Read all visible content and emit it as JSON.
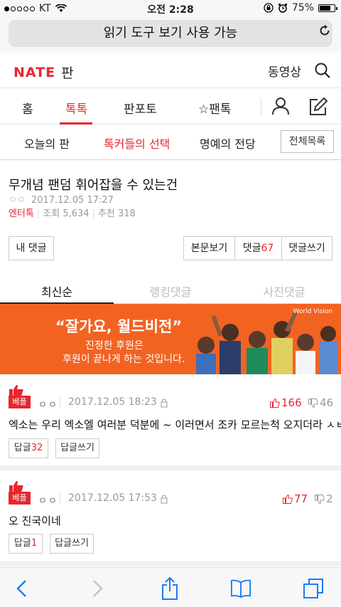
{
  "status_bar": {
    "carrier": "KT",
    "time": "오전 2:28",
    "battery_percent": "75%",
    "battery_level": 0.75
  },
  "url_bar": {
    "text": "읽기 도구 보기 사용 가능"
  },
  "header": {
    "logo": "NATE",
    "section": "판",
    "video_link": "동영상"
  },
  "main_nav": {
    "items": [
      {
        "label": "홈"
      },
      {
        "label": "톡톡"
      },
      {
        "label": "판포토"
      },
      {
        "label": "☆팬톡"
      }
    ],
    "active": "톡톡"
  },
  "sub_nav": {
    "items": [
      {
        "label": "오늘의 판"
      },
      {
        "label": "톡커들의 선택"
      },
      {
        "label": "명예의 전당"
      }
    ],
    "active": "톡커들의 선택",
    "full_list": "전체목록"
  },
  "article": {
    "title": "무개념 팬덤 휘어잡을 수 있는건",
    "author": "ㅇㅇ",
    "date": "2017.12.05 17:27",
    "category": "엔터톡",
    "views": "조회 5,634",
    "recommends": "추천 318",
    "my_comments": "내 댓글",
    "view_body": "본문보기",
    "comments_label": "댓글",
    "comments_count": "67",
    "write_comment": "댓글쓰기"
  },
  "comment_tabs": {
    "items": [
      {
        "label": "최신순"
      },
      {
        "label": "랭킹댓글"
      },
      {
        "label": "사진댓글"
      }
    ],
    "active": "최신순"
  },
  "banner": {
    "headline": "“잘가요, 월드비전”",
    "line1": "진정한 후원은",
    "line2": "후원이 끝나게 하는 것입니다.",
    "brand": "World Vision",
    "background": "#f26322"
  },
  "comments": [
    {
      "badge": "베플",
      "author": "ㅇㅇ",
      "date": "2017.12.05 18:23",
      "likes": "166",
      "dislikes": "46",
      "text": "엑소는 우리 엑소엘 여러분 덕분에 ~ 이러면서 조카 모르는척 오지더라 ㅅㅂ",
      "reply_label": "답글",
      "reply_count": "32",
      "write_reply": "답글쓰기"
    },
    {
      "badge": "베플",
      "author": "ㅇㅇ",
      "date": "2017.12.05 17:53",
      "likes": "77",
      "dislikes": "2",
      "text": "오 진국이네",
      "reply_label": "답글",
      "reply_count": "1",
      "write_reply": "답글쓰기"
    }
  ],
  "colors": {
    "accent": "#e8262d",
    "banner": "#f26322",
    "toolbar_icon": "#1a7cf5"
  },
  "toolbar": {
    "icons": [
      "back-icon",
      "forward-icon",
      "share-icon",
      "bookmarks-icon",
      "tabs-icon"
    ]
  }
}
